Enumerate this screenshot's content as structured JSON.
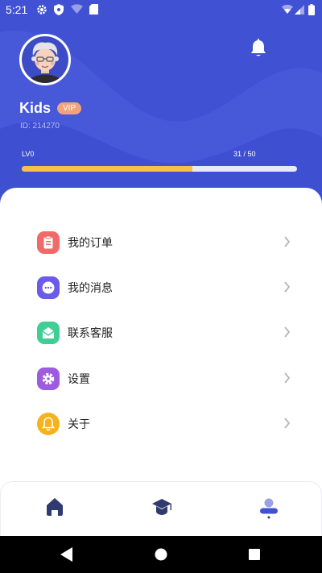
{
  "status_bar": {
    "time": "5:21"
  },
  "profile": {
    "username": "Kids",
    "vip_badge": "VIP",
    "user_id": "ID: 214270",
    "level_label": "LV0",
    "xp_text": "31 / 50",
    "xp_progress": 0.62
  },
  "menu": {
    "items": [
      {
        "label": "我的订单",
        "icon": "clipboard-icon",
        "color": "#f06a6a"
      },
      {
        "label": "我的消息",
        "icon": "chat-bubble-icon",
        "color": "#6a5bea"
      },
      {
        "label": "联系客服",
        "icon": "envelope-icon",
        "color": "#3fcf94"
      },
      {
        "label": "设置",
        "icon": "gear-icon",
        "color": "#9d5be0"
      },
      {
        "label": "关于",
        "icon": "bell-icon",
        "color": "#f5b21c"
      }
    ]
  },
  "tab_bar": {
    "tabs": [
      {
        "icon": "home-icon",
        "active": false
      },
      {
        "icon": "graduation-cap-icon",
        "active": false
      },
      {
        "icon": "user-icon",
        "active": true
      }
    ]
  },
  "colors": {
    "header": "#4051d4",
    "progress_fill": "#f7c04a",
    "vip_badge": "#f2a37b",
    "tab_icon": "#2f3a6e",
    "tab_active": "#4051d4"
  }
}
